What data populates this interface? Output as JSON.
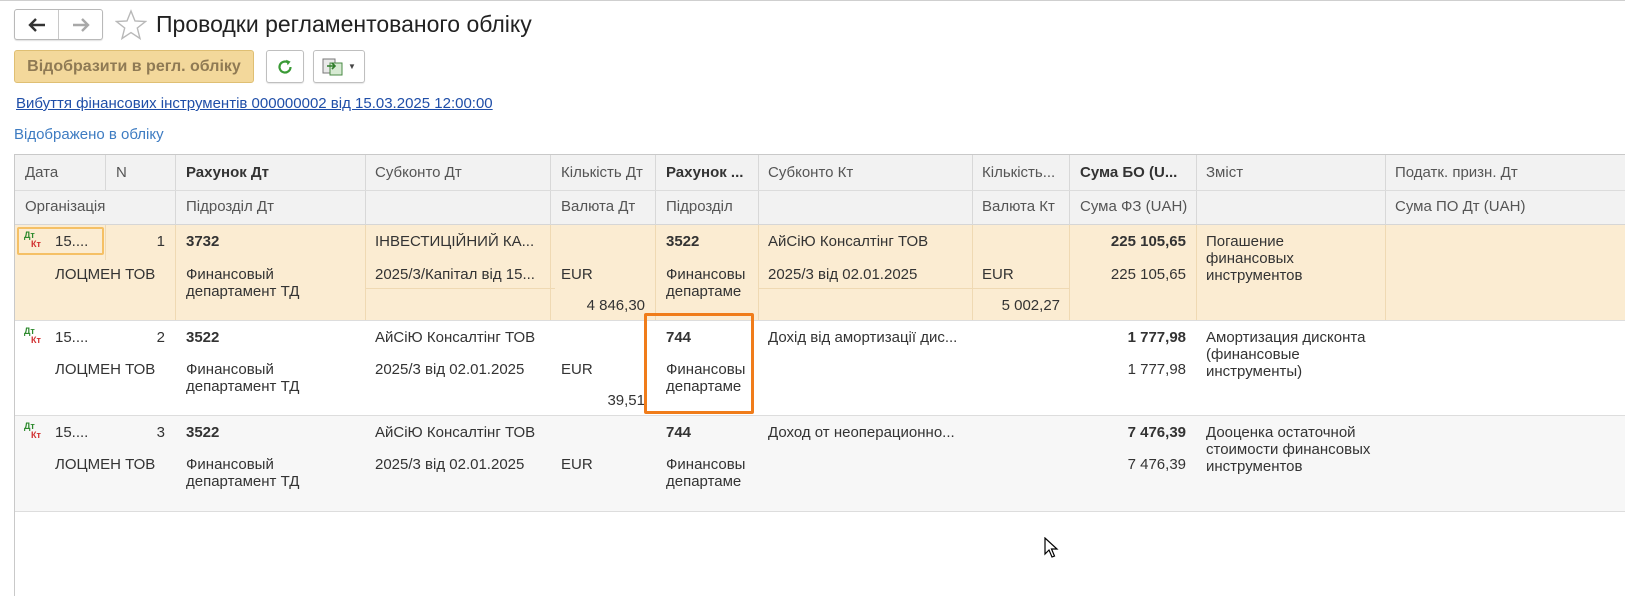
{
  "window": {
    "title": "Проводки регламентованого обліку"
  },
  "toolbar": {
    "main_button_label": "Відобразити в регл. обліку",
    "refresh_icon": "refresh-icon",
    "export_icon": "export-icon"
  },
  "document_link": "Вибуття фінансових інструментів 000000002 від 15.03.2025 12:00:00",
  "status_text": "Відображено в обліку",
  "table": {
    "headers": {
      "date": "Дата",
      "n": "N",
      "org": "Організація",
      "acc_dt": "Рахунок Дт",
      "dept_dt": "Підрозділ Дт",
      "sub_dt": "Субконто Дт",
      "qty_dt": "Кількість Дт",
      "cur_dt": "Валюта Дт",
      "acc_kt": "Рахунок ...",
      "dept_kt": "Підрозділ",
      "sub_kt": "Субконто Кт",
      "qty_kt": "Кількість...",
      "cur_kt": "Валюта Кт",
      "sum_bo": "Сума БО (U...",
      "sum_fz": "Сума ФЗ (UAH)",
      "content": "Зміст",
      "tax_dt": "Податк. призн. Дт",
      "sum_po": "Сума ПО Дт (UAH)"
    },
    "rows": [
      {
        "date": "15....",
        "n": "1",
        "org": "ЛОЦМЕН ТОВ",
        "acc_dt": "3732",
        "dept_dt": "Финансовый департамент ТД",
        "sub_dt_1": "ІНВЕСТИЦІЙНИЙ КА...",
        "sub_dt_2": "2025/3/Капітал від 15...",
        "cur_dt": "EUR",
        "qty_cur_dt": "4 846,30",
        "acc_kt": "3522",
        "dept_kt": "Финансовы департаме",
        "sub_kt_1": "АйСіЮ Консалтінг ТОВ",
        "sub_kt_2": "2025/3 від 02.01.2025",
        "cur_kt": "EUR",
        "qty_cur_kt": "5 002,27",
        "sum_bo": "225 105,65",
        "sum_fz": "225 105,65",
        "content": "Погашение финансовых инструментов"
      },
      {
        "date": "15....",
        "n": "2",
        "org": "ЛОЦМЕН ТОВ",
        "acc_dt": "3522",
        "dept_dt": "Финансовый департамент ТД",
        "sub_dt_1": "АйСіЮ Консалтінг ТОВ",
        "sub_dt_2": "2025/3 від 02.01.2025",
        "cur_dt": "EUR",
        "qty_cur_dt": "39,51",
        "acc_kt": "744",
        "dept_kt": "Финансовы департаме",
        "sub_kt_1": "Дохід від амортизації дис...",
        "sub_kt_2": "",
        "cur_kt": "",
        "qty_cur_kt": "",
        "sum_bo": "1 777,98",
        "sum_fz": "1 777,98",
        "content": "Амортизация дисконта (финансовые инструменты)"
      },
      {
        "date": "15....",
        "n": "3",
        "org": "ЛОЦМЕН ТОВ",
        "acc_dt": "3522",
        "dept_dt": "Финансовый департамент ТД",
        "sub_dt_1": "АйСіЮ Консалтінг ТОВ",
        "sub_dt_2": "2025/3 від 02.01.2025",
        "cur_dt": "EUR",
        "qty_cur_dt": "",
        "acc_kt": "744",
        "dept_kt": "Финансовы департаме",
        "sub_kt_1": "Доход от неоперационно...",
        "sub_kt_2": "",
        "cur_kt": "",
        "qty_cur_kt": "",
        "sum_bo": "7 476,39",
        "sum_fz": "7 476,39",
        "content": "Дооценка остаточной стоимости финансовых инструментов"
      }
    ]
  },
  "colors": {
    "selected_row": "#fbecd2",
    "focus_border": "#f07c1a",
    "link": "#1f4ea8",
    "primary_button": "#f3d89b"
  }
}
